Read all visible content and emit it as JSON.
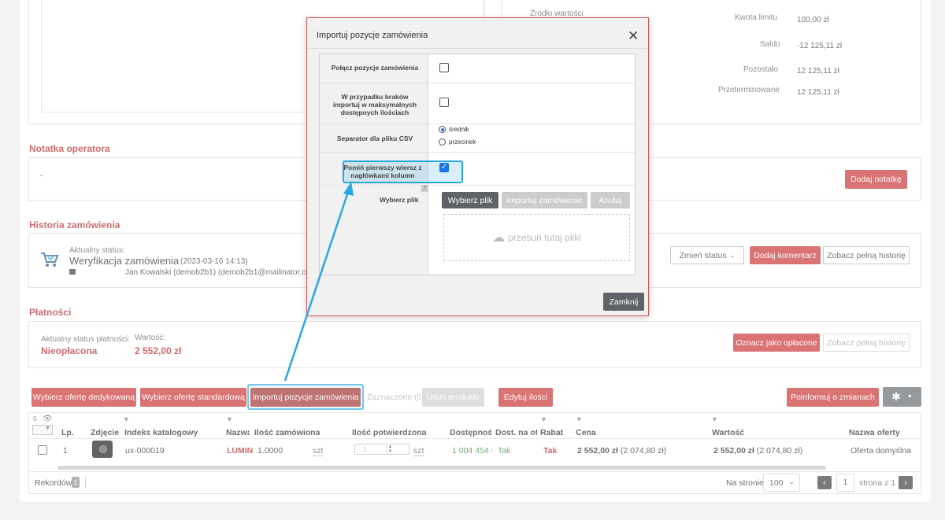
{
  "top_panel": {
    "zrodlo_label": "Źródło wartości",
    "kwota_limitu_label": "Kwota limitu",
    "kwota_limitu_value": "100,00 zł",
    "saldo_label": "Saldo",
    "saldo_value": "-12 125,11 zł",
    "pozostalo_label": "Pozostało",
    "pozostalo_value": "12 125,11 zł",
    "przeterminowane_label": "Przeterminowane",
    "przeterminowane_value": "12 125,11 zł"
  },
  "notatka": {
    "title": "Notatka operatora",
    "content": "-",
    "add_button": "Dodaj notatkę"
  },
  "historia": {
    "title": "Historia zamówienia",
    "current_status_label": "Aktualny status:",
    "status": "Weryfikacja zamówienia",
    "status_date": "(2023-03-16 14:13)",
    "user": "Jan Kowalski (demob2b1) (demob2b1@mailinator.com)",
    "change_status_button": "Zmień status",
    "add_comment_button": "Dodaj komentarz",
    "full_history_button": "Zobacz pełną historię"
  },
  "platnosci": {
    "title": "Płatności",
    "status_label": "Aktualny status płatności:",
    "status_value": "Nieopłacona",
    "amount_label": "Wartość:",
    "amount_value": "2 552,00 zł",
    "mark_paid_button": "Oznacz jako opłacone",
    "full_history_button": "Zobacz pełną historię"
  },
  "toolbar": {
    "dedicated_offer": "Wybierz ofertę dedykowaną",
    "standard_offer": "Wybierz ofertę standardową",
    "import_positions": "Importuj pozycje zamówienia",
    "selected_count": "Zaznaczone (0)",
    "remove_products": "Usuń produkty",
    "edit_quantities": "Edytuj ilości",
    "inform_changes": "Poinformuj o zmianach"
  },
  "table": {
    "header_counter": "0",
    "columns": [
      "Lp.",
      "Zdjęcie",
      "Indeks katalogowy",
      "Nazwa",
      "Ilość zamówiona",
      "Ilość potwierdzona",
      "Dostępność",
      "Dost. na ofer",
      "Rabat",
      "Cena",
      "Wartość",
      "Nazwa oferty"
    ],
    "rows": [
      {
        "lp": "1",
        "index": "ux-000019",
        "name": "LUMIN",
        "qty_ordered": "1.0000",
        "qty_unit": "szt",
        "qty_confirmed": "1",
        "qty_confirmed_unit": "szt",
        "availability": "1 004 454 s",
        "availability_offer": "Tak",
        "rabat": "Tak",
        "price_bold": "2 552,00 zł",
        "price_extra": "(2 074,80 zł)",
        "value_bold": "2 552,00 zł",
        "value_extra": "(2 074,80 zł)",
        "offer_name": "Oferta domyślna"
      }
    ],
    "records_label": "Rekordów:",
    "records_count": "1",
    "per_page_label": "Na stronie",
    "per_page_value": "100",
    "page_value": "1",
    "page_of": "strona z 1"
  },
  "modal": {
    "title": "Importuj pozycje zamówienia",
    "merge_label": "Połącz pozycje zamówienia",
    "shortage_label": "W przypadku braków importuj w maksymalnych dostępnych ilościach",
    "separator_label": "Separator dla pliku CSV",
    "separator_options": [
      "średnik",
      "przecinek"
    ],
    "separator_selected": "średnik",
    "skip_header_label": "Pomiń pierwszy wiersz z nagłówkami kolumn",
    "skip_header_checked": true,
    "choose_file_label": "Wybierz plik",
    "help_mark": "?",
    "choose_file_button": "Wybierz plik",
    "import_button": "Importuj zamówienie",
    "cancel_button": "Anuluj",
    "dropzone_text": "przesuń tutaj pliki",
    "close_button": "Zamknij"
  },
  "colors": {
    "accent_red": "#c62828",
    "highlight_blue": "#29a8e0"
  }
}
